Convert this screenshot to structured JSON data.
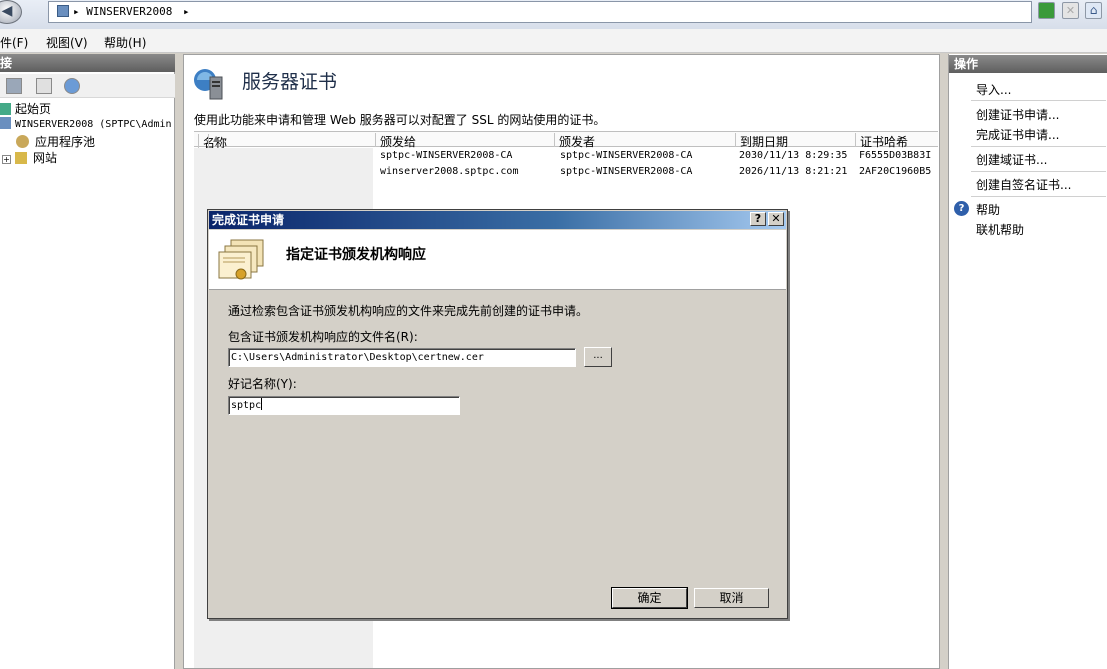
{
  "window": {
    "address_path": "WINSERVER2008",
    "address_arrow": "▸"
  },
  "menu": [
    {
      "label": "件(F)"
    },
    {
      "label": "视图(V)"
    },
    {
      "label": "帮助(H)"
    }
  ],
  "connections": {
    "title": "接",
    "tree": [
      {
        "label": "起始页"
      },
      {
        "label": "WINSERVER2008 (SPTPC\\Admin"
      },
      {
        "label": "应用程序池"
      },
      {
        "label": "网站"
      }
    ]
  },
  "center": {
    "title": "服务器证书",
    "description": "使用此功能来申请和管理 Web 服务器可以对配置了 SSL 的网站使用的证书。",
    "columns": [
      "名称",
      "颁发给",
      "颁发者",
      "到期日期",
      "证书哈希"
    ],
    "sort_indicator": "▲",
    "rows": [
      {
        "name": "",
        "issued_to": "sptpc-WINSERVER2008-CA",
        "issued_by": "sptpc-WINSERVER2008-CA",
        "expires": "2030/11/13 8:29:35",
        "hash": "F6555D03B83I"
      },
      {
        "name": "",
        "issued_to": "winserver2008.sptpc.com",
        "issued_by": "sptpc-WINSERVER2008-CA",
        "expires": "2026/11/13 8:21:21",
        "hash": "2AF20C1960B5"
      }
    ]
  },
  "actions": {
    "title": "操作",
    "items": [
      {
        "label": "导入..."
      },
      {
        "label": "创建证书申请..."
      },
      {
        "label": "完成证书申请..."
      },
      {
        "label": "创建域证书..."
      },
      {
        "label": "创建自签名证书..."
      },
      {
        "label": "帮助"
      },
      {
        "label": "联机帮助"
      }
    ]
  },
  "dialog": {
    "title": "完成证书申请",
    "help_glyph": "?",
    "close_glyph": "✕",
    "heading": "指定证书颁发机构响应",
    "description": "通过检索包含证书颁发机构响应的文件来完成先前创建的证书申请。",
    "file_label": "包含证书颁发机构响应的文件名(R):",
    "file_value": "C:\\Users\\Administrator\\Desktop\\certnew.cer",
    "browse_label": "...",
    "name_label": "好记名称(Y):",
    "name_value": "sptpc",
    "ok_label": "确定",
    "cancel_label": "取消"
  }
}
